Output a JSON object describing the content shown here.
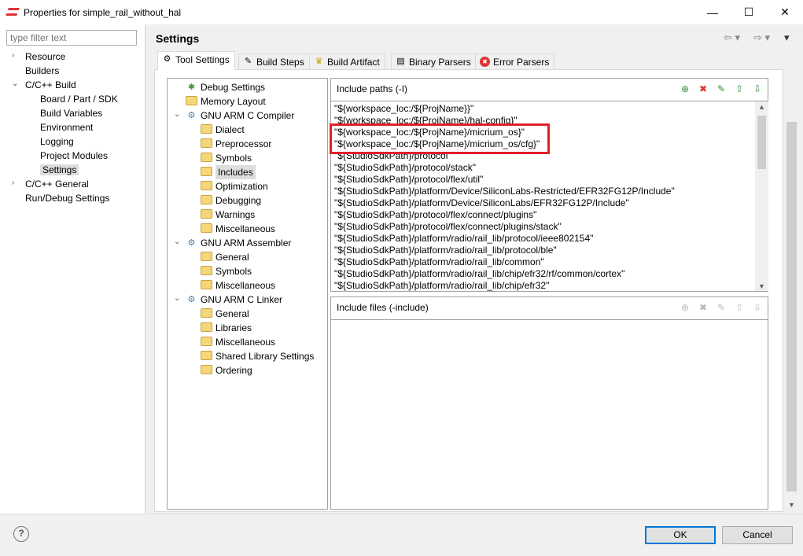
{
  "window": {
    "title": "Properties for simple_rail_without_hal",
    "minimize": "—",
    "maximize": "☐",
    "close": "✕"
  },
  "filter": {
    "placeholder": "type filter text"
  },
  "left_tree": [
    {
      "label": "Resource",
      "level": 0,
      "twisty": "›"
    },
    {
      "label": "Builders",
      "level": 0,
      "twisty": ""
    },
    {
      "label": "C/C++ Build",
      "level": 0,
      "twisty": "⌄"
    },
    {
      "label": "Board / Part / SDK",
      "level": 1,
      "twisty": ""
    },
    {
      "label": "Build Variables",
      "level": 1,
      "twisty": ""
    },
    {
      "label": "Environment",
      "level": 1,
      "twisty": ""
    },
    {
      "label": "Logging",
      "level": 1,
      "twisty": ""
    },
    {
      "label": "Project Modules",
      "level": 1,
      "twisty": ""
    },
    {
      "label": "Settings",
      "level": 1,
      "twisty": "",
      "selected": true
    },
    {
      "label": "C/C++ General",
      "level": 0,
      "twisty": "›"
    },
    {
      "label": "Run/Debug Settings",
      "level": 0,
      "twisty": ""
    }
  ],
  "header": {
    "title": "Settings",
    "back": "⇦ ▾",
    "forward": "⇨ ▾",
    "menu": "▾"
  },
  "tabs": [
    {
      "label": "Tool Settings",
      "icon": "⚙",
      "active": true
    },
    {
      "label": "Build Steps",
      "icon": "✎"
    },
    {
      "label": "Build Artifact",
      "icon": "♛"
    },
    {
      "label": "Binary Parsers",
      "icon": "▤"
    },
    {
      "label": "Error Parsers",
      "icon": "✖"
    }
  ],
  "tool_tree": [
    {
      "label": "Debug Settings",
      "level": 0,
      "twisty": "",
      "icon": "bug"
    },
    {
      "label": "Memory Layout",
      "level": 0,
      "twisty": "",
      "icon": "folder"
    },
    {
      "label": "GNU ARM C Compiler",
      "level": 0,
      "twisty": "⌄",
      "icon": "gear"
    },
    {
      "label": "Dialect",
      "level": 1,
      "icon": "folder"
    },
    {
      "label": "Preprocessor",
      "level": 1,
      "icon": "folder"
    },
    {
      "label": "Symbols",
      "level": 1,
      "icon": "folder"
    },
    {
      "label": "Includes",
      "level": 1,
      "icon": "folder",
      "selected": true
    },
    {
      "label": "Optimization",
      "level": 1,
      "icon": "folder"
    },
    {
      "label": "Debugging",
      "level": 1,
      "icon": "folder"
    },
    {
      "label": "Warnings",
      "level": 1,
      "icon": "folder"
    },
    {
      "label": "Miscellaneous",
      "level": 1,
      "icon": "folder"
    },
    {
      "label": "GNU ARM Assembler",
      "level": 0,
      "twisty": "⌄",
      "icon": "gear"
    },
    {
      "label": "General",
      "level": 1,
      "icon": "folder"
    },
    {
      "label": "Symbols",
      "level": 1,
      "icon": "folder"
    },
    {
      "label": "Miscellaneous",
      "level": 1,
      "icon": "folder"
    },
    {
      "label": "GNU ARM C Linker",
      "level": 0,
      "twisty": "⌄",
      "icon": "gear"
    },
    {
      "label": "General",
      "level": 1,
      "icon": "folder"
    },
    {
      "label": "Libraries",
      "level": 1,
      "icon": "folder"
    },
    {
      "label": "Miscellaneous",
      "level": 1,
      "icon": "folder"
    },
    {
      "label": "Shared Library Settings",
      "level": 1,
      "icon": "folder"
    },
    {
      "label": "Ordering",
      "level": 1,
      "icon": "folder"
    }
  ],
  "include_paths": {
    "title": "Include paths (-I)",
    "items": [
      "\"${workspace_loc:/${ProjName}}\"",
      "\"${workspace_loc:/${ProjName}/hal-config}\"",
      "\"${workspace_loc:/${ProjName}/micrium_os}\"",
      "\"${workspace_loc:/${ProjName}/micrium_os/cfg}\"",
      "\"${StudioSdkPath}/protocol\"",
      "\"${StudioSdkPath}/protocol/stack\"",
      "\"${StudioSdkPath}/protocol/flex/util\"",
      "\"${StudioSdkPath}/platform/Device/SiliconLabs-Restricted/EFR32FG12P/Include\"",
      "\"${StudioSdkPath}/platform/Device/SiliconLabs/EFR32FG12P/Include\"",
      "\"${StudioSdkPath}/protocol/flex/connect/plugins\"",
      "\"${StudioSdkPath}/protocol/flex/connect/plugins/stack\"",
      "\"${StudioSdkPath}/platform/radio/rail_lib/protocol/ieee802154\"",
      "\"${StudioSdkPath}/platform/radio/rail_lib/protocol/ble\"",
      "\"${StudioSdkPath}/platform/radio/rail_lib/common\"",
      "\"${StudioSdkPath}/platform/radio/rail_lib/chip/efr32/rf/common/cortex\"",
      "\"${StudioSdkPath}/platform/radio/rail_lib/chip/efr32\""
    ]
  },
  "include_files": {
    "title": "Include files (-include)"
  },
  "toolbar_icons": [
    "add",
    "delete",
    "edit",
    "move-up",
    "move-down"
  ],
  "toolbar_glyphs": [
    "⊕",
    "✖",
    "✎",
    "⇧",
    "⇩"
  ],
  "footer": {
    "help": "?",
    "ok": "OK",
    "cancel": "Cancel"
  },
  "colors": {
    "highlight": "#e0202a",
    "ok_border": "#0078d7"
  }
}
